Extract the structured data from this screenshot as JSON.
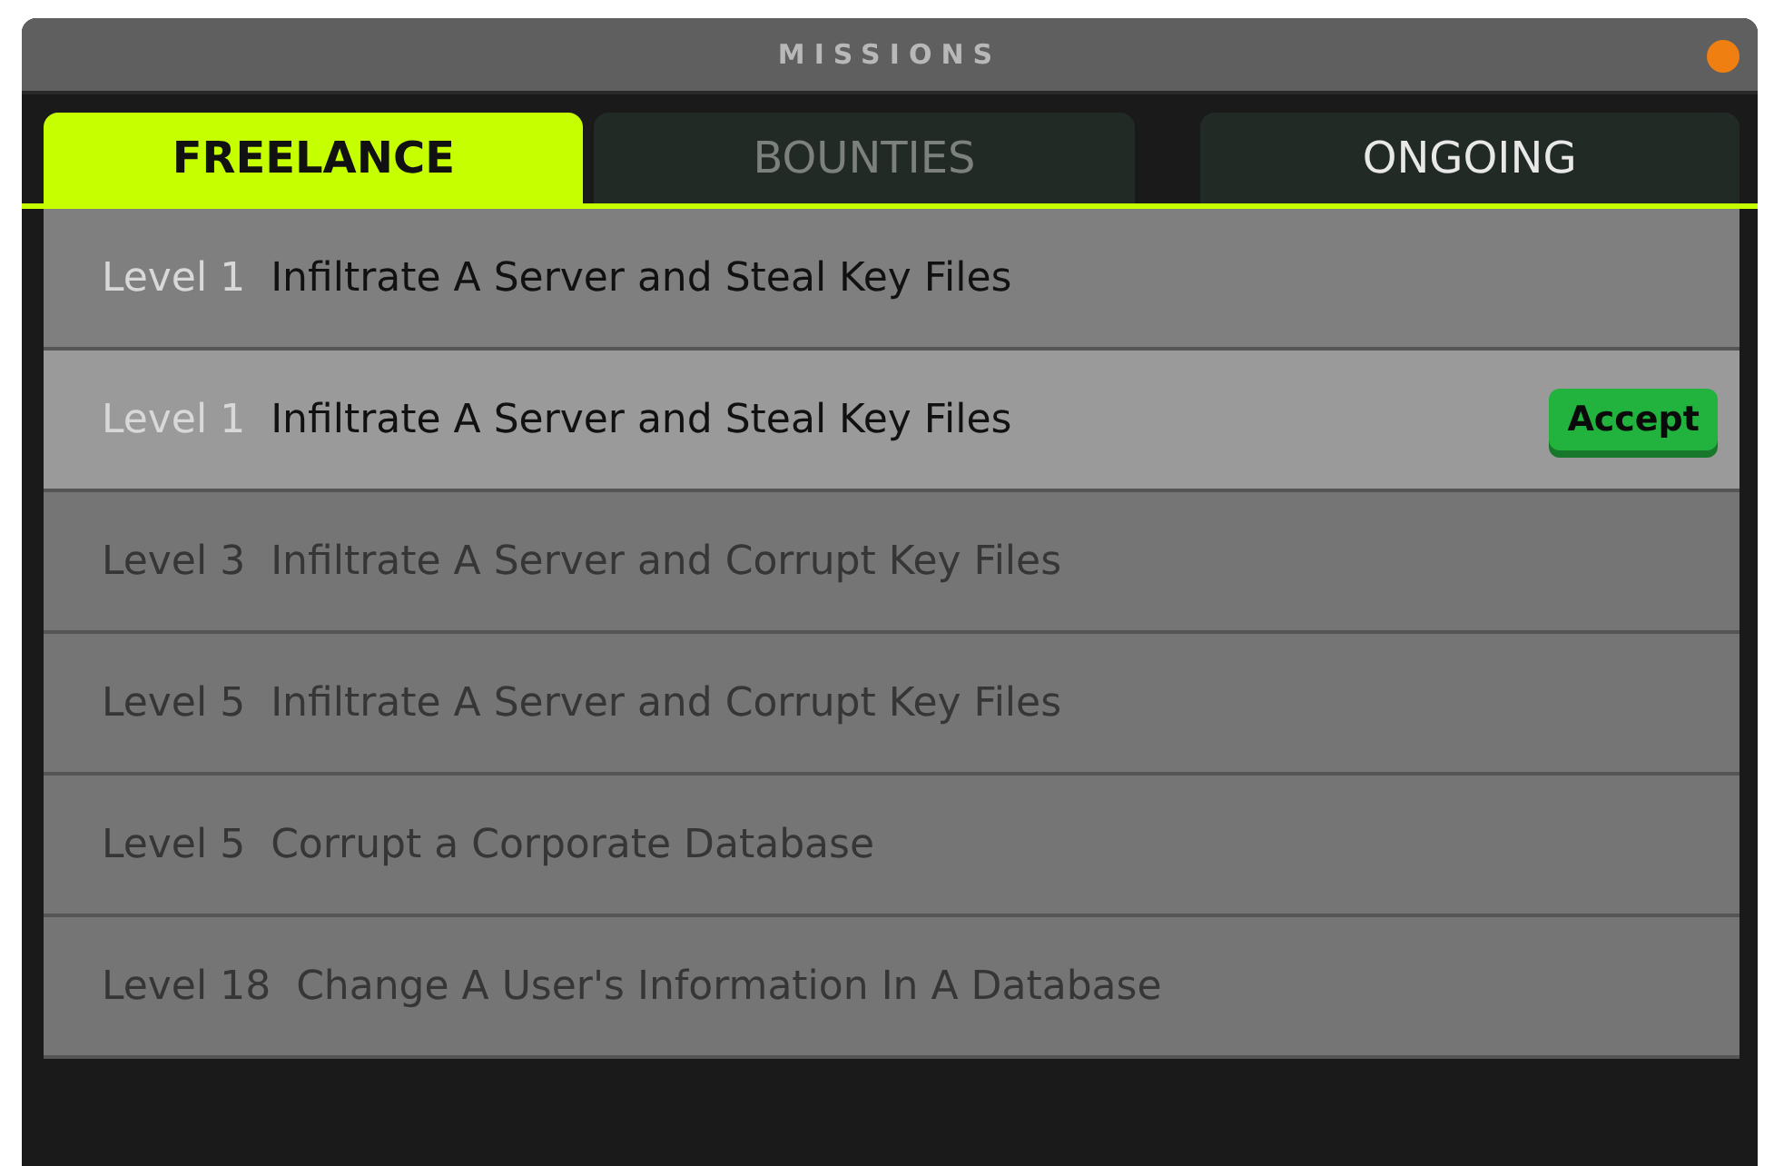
{
  "window": {
    "title": "MISSIONS",
    "status_light": {
      "color": "#f07f12"
    }
  },
  "tabs": [
    {
      "label": "FREELANCE",
      "selected": true,
      "disabled": false
    },
    {
      "label": "BOUNTIES",
      "selected": false,
      "disabled": true
    },
    {
      "label": "ONGOING",
      "selected": false,
      "disabled": false
    }
  ],
  "missions": [
    {
      "level": "Level 1",
      "title": "Infiltrate A Server and Steal Key Files",
      "locked": false,
      "selected": false
    },
    {
      "level": "Level 1",
      "title": "Infiltrate A Server and Steal Key Files",
      "locked": false,
      "selected": true,
      "action": "Accept"
    },
    {
      "level": "Level 3",
      "title": "Infiltrate A Server and Corrupt Key Files",
      "locked": true,
      "selected": false
    },
    {
      "level": "Level 5",
      "title": "Infiltrate A Server and Corrupt Key Files",
      "locked": true,
      "selected": false
    },
    {
      "level": "Level 5",
      "title": "Corrupt a Corporate Database",
      "locked": true,
      "selected": false
    },
    {
      "level": "Level 18",
      "title": "Change A User's Information In A Database",
      "locked": true,
      "selected": false
    }
  ]
}
